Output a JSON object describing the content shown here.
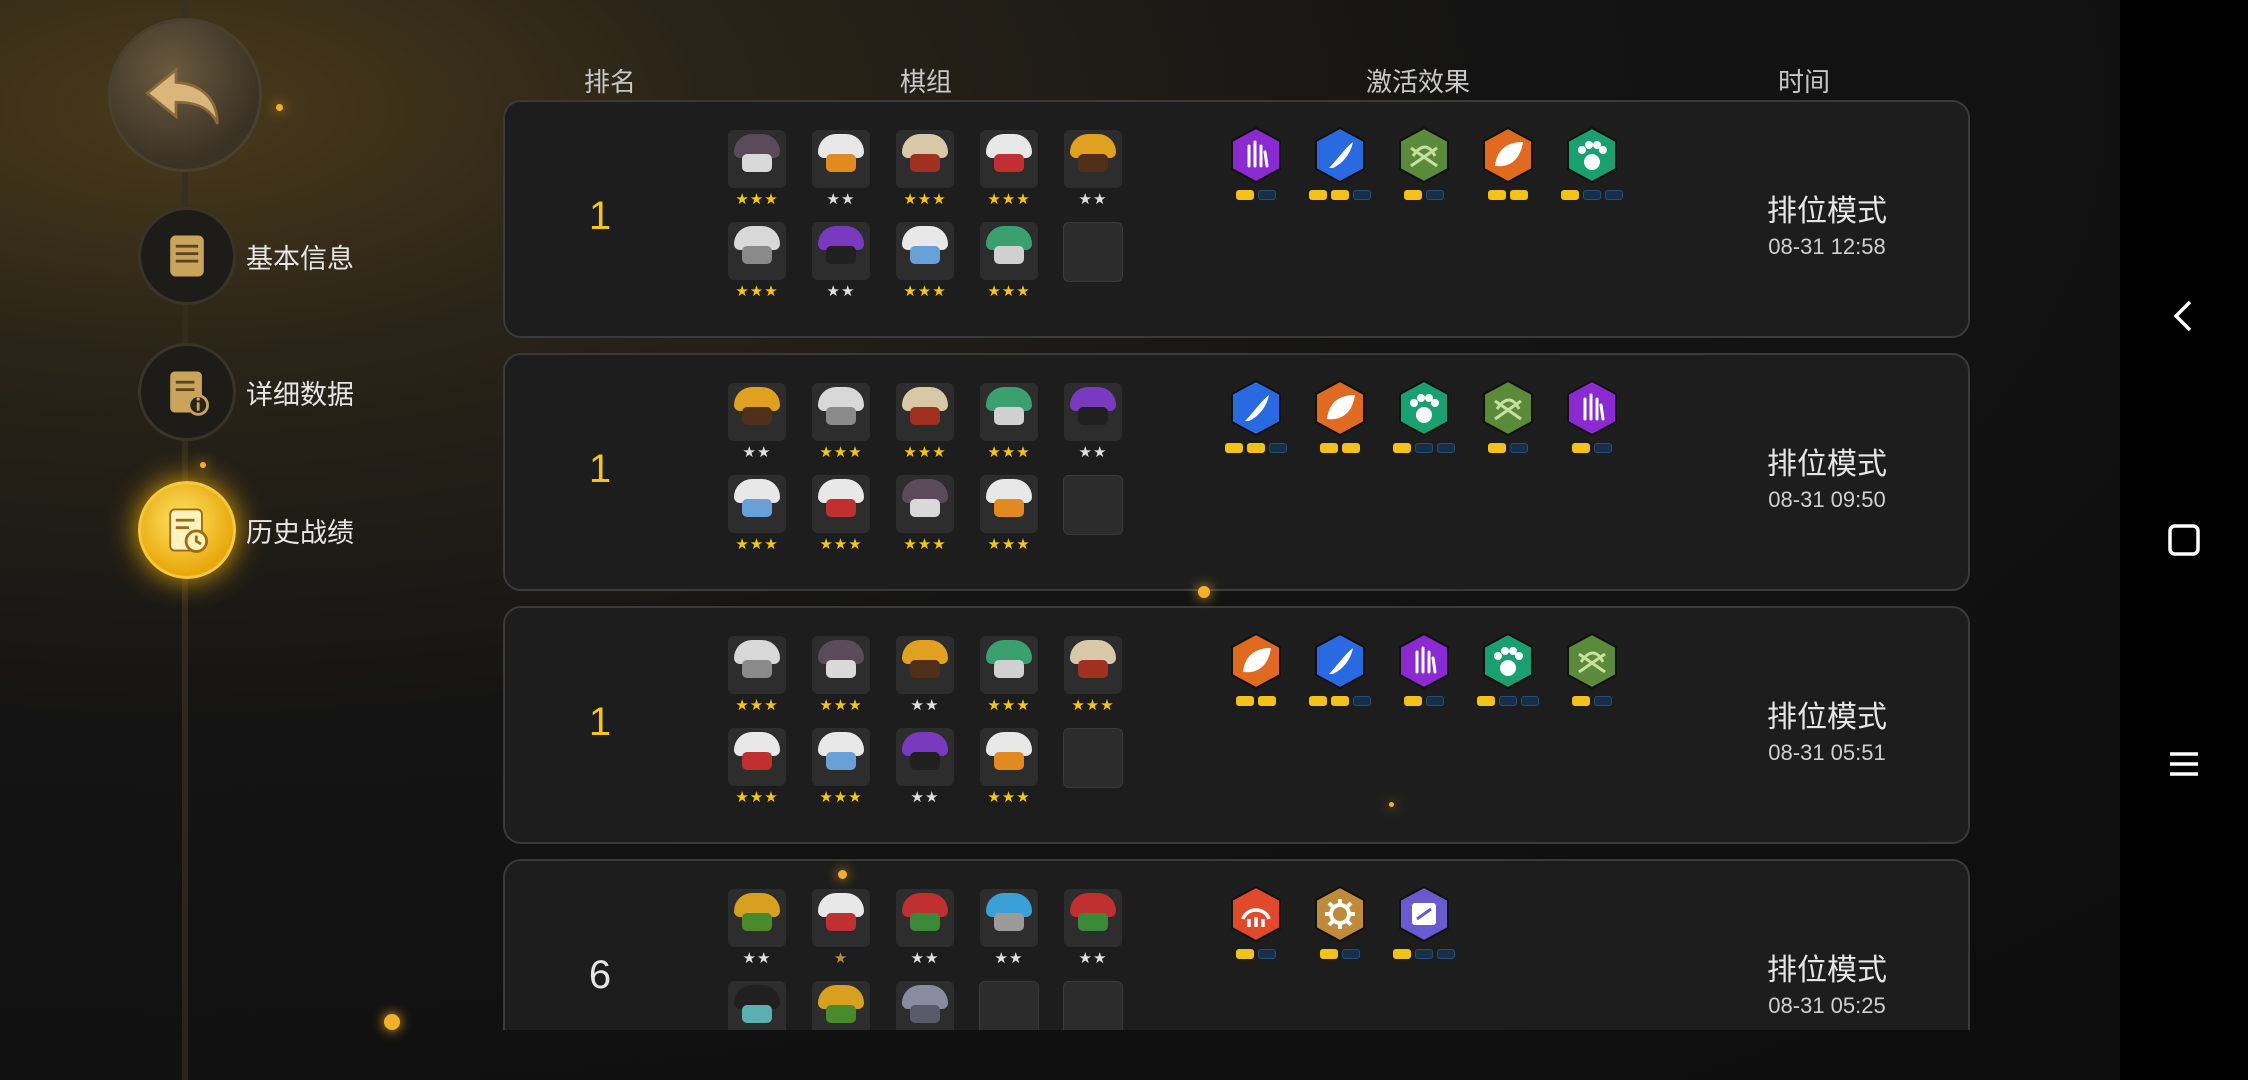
{
  "nav": {
    "items": [
      {
        "label": "基本信息",
        "icon": "notepad-icon"
      },
      {
        "label": "详细数据",
        "icon": "report-info-icon"
      },
      {
        "label": "历史战绩",
        "icon": "history-clock-icon"
      }
    ]
  },
  "columns": {
    "rank": "排名",
    "lineup": "棋组",
    "traits": "激活效果",
    "time": "时间"
  },
  "colors": {
    "accent": "#f5c518",
    "row_bg": "#1d1d1d"
  },
  "matches": [
    {
      "rank": "1",
      "mode": "排位模式",
      "time": "08-31 12:58",
      "units": [
        {
          "stars": "★★★",
          "tier": "gold",
          "hood": "#5a4a5a",
          "mask": "#d9d9d9"
        },
        {
          "stars": "★★",
          "tier": "silver",
          "hood": "#e8e8e8",
          "mask": "#e08a20"
        },
        {
          "stars": "★★★",
          "tier": "gold",
          "hood": "#d8c8a8",
          "mask": "#a03020"
        },
        {
          "stars": "★★★",
          "tier": "gold",
          "hood": "#e8e8e8",
          "mask": "#c03030"
        },
        {
          "stars": "★★",
          "tier": "silver",
          "hood": "#e0a020",
          "mask": "#503018"
        },
        {
          "stars": "★★★",
          "tier": "gold",
          "hood": "#d8d8d8",
          "mask": "#8a8a8a"
        },
        {
          "stars": "★★",
          "tier": "silver",
          "hood": "#7a3ac0",
          "mask": "#202020"
        },
        {
          "stars": "★★★",
          "tier": "gold",
          "hood": "#e8e8e8",
          "mask": "#6aa0d8"
        },
        {
          "stars": "★★★",
          "tier": "gold",
          "hood": "#3aa070",
          "mask": "#d0d0d0"
        },
        {
          "empty": true
        }
      ],
      "traits": [
        {
          "icon": "purple-hand-icon",
          "color": "#8a2ad0",
          "pips": [
            1,
            0
          ]
        },
        {
          "icon": "blue-feather-icon",
          "color": "#2a6ae0",
          "pips": [
            1,
            1,
            0
          ]
        },
        {
          "icon": "green-crossbow-icon",
          "color": "#5a8a3a",
          "pips": [
            1,
            0
          ]
        },
        {
          "icon": "orange-leaf-icon",
          "color": "#e06a20",
          "pips": [
            1,
            1
          ]
        },
        {
          "icon": "teal-paw-icon",
          "color": "#1aa070",
          "pips": [
            1,
            0,
            0
          ]
        }
      ]
    },
    {
      "rank": "1",
      "mode": "排位模式",
      "time": "08-31 09:50",
      "units": [
        {
          "stars": "★★",
          "tier": "silver",
          "hood": "#e0a020",
          "mask": "#503018"
        },
        {
          "stars": "★★★",
          "tier": "gold",
          "hood": "#d8d8d8",
          "mask": "#8a8a8a"
        },
        {
          "stars": "★★★",
          "tier": "gold",
          "hood": "#d8c8a8",
          "mask": "#a03020"
        },
        {
          "stars": "★★★",
          "tier": "gold",
          "hood": "#3aa070",
          "mask": "#d0d0d0"
        },
        {
          "stars": "★★",
          "tier": "silver",
          "hood": "#7a3ac0",
          "mask": "#202020"
        },
        {
          "stars": "★★★",
          "tier": "gold",
          "hood": "#e8e8e8",
          "mask": "#6aa0d8"
        },
        {
          "stars": "★★★",
          "tier": "gold",
          "hood": "#e8e8e8",
          "mask": "#c03030"
        },
        {
          "stars": "★★★",
          "tier": "gold",
          "hood": "#5a4a5a",
          "mask": "#d9d9d9"
        },
        {
          "stars": "★★★",
          "tier": "gold",
          "hood": "#e8e8e8",
          "mask": "#e08a20"
        },
        {
          "empty": true
        }
      ],
      "traits": [
        {
          "icon": "blue-feather-icon",
          "color": "#2a6ae0",
          "pips": [
            1,
            1,
            0
          ]
        },
        {
          "icon": "orange-leaf-icon",
          "color": "#e06a20",
          "pips": [
            1,
            1
          ]
        },
        {
          "icon": "teal-paw-icon",
          "color": "#1aa070",
          "pips": [
            1,
            0,
            0
          ]
        },
        {
          "icon": "green-crossbow-icon",
          "color": "#5a8a3a",
          "pips": [
            1,
            0
          ]
        },
        {
          "icon": "purple-hand-icon",
          "color": "#8a2ad0",
          "pips": [
            1,
            0
          ]
        }
      ]
    },
    {
      "rank": "1",
      "mode": "排位模式",
      "time": "08-31 05:51",
      "units": [
        {
          "stars": "★★★",
          "tier": "gold",
          "hood": "#d8d8d8",
          "mask": "#8a8a8a"
        },
        {
          "stars": "★★★",
          "tier": "gold",
          "hood": "#5a4a5a",
          "mask": "#d9d9d9"
        },
        {
          "stars": "★★",
          "tier": "silver",
          "hood": "#e0a020",
          "mask": "#503018"
        },
        {
          "stars": "★★★",
          "tier": "gold",
          "hood": "#3aa070",
          "mask": "#d0d0d0"
        },
        {
          "stars": "★★★",
          "tier": "gold",
          "hood": "#d8c8a8",
          "mask": "#a03020"
        },
        {
          "stars": "★★★",
          "tier": "gold",
          "hood": "#e8e8e8",
          "mask": "#c03030"
        },
        {
          "stars": "★★★",
          "tier": "gold",
          "hood": "#e8e8e8",
          "mask": "#6aa0d8"
        },
        {
          "stars": "★★",
          "tier": "silver",
          "hood": "#7a3ac0",
          "mask": "#202020"
        },
        {
          "stars": "★★★",
          "tier": "gold",
          "hood": "#e8e8e8",
          "mask": "#e08a20"
        },
        {
          "empty": true
        }
      ],
      "traits": [
        {
          "icon": "orange-leaf-icon",
          "color": "#e06a20",
          "pips": [
            1,
            1
          ]
        },
        {
          "icon": "blue-feather-icon",
          "color": "#2a6ae0",
          "pips": [
            1,
            1,
            0
          ]
        },
        {
          "icon": "purple-hand-icon",
          "color": "#8a2ad0",
          "pips": [
            1,
            0
          ]
        },
        {
          "icon": "teal-paw-icon",
          "color": "#1aa070",
          "pips": [
            1,
            0,
            0
          ]
        },
        {
          "icon": "green-crossbow-icon",
          "color": "#5a8a3a",
          "pips": [
            1,
            0
          ]
        }
      ]
    },
    {
      "rank": "6",
      "mode": "排位模式",
      "time": "08-31 05:25",
      "units": [
        {
          "stars": "★★",
          "tier": "silver",
          "hood": "#d8a020",
          "mask": "#4a8a2a"
        },
        {
          "stars": "★",
          "tier": "bronze",
          "hood": "#e8e8e8",
          "mask": "#c03030"
        },
        {
          "stars": "★★",
          "tier": "silver",
          "hood": "#c03030",
          "mask": "#3a8a3a"
        },
        {
          "stars": "★★",
          "tier": "silver",
          "hood": "#3aa0d8",
          "mask": "#9a9a9a"
        },
        {
          "stars": "★★",
          "tier": "silver",
          "hood": "#c03030",
          "mask": "#3a8a3a"
        },
        {
          "stars": "",
          "tier": "silver",
          "hood": "#202020",
          "mask": "#5ab0b0"
        },
        {
          "stars": "",
          "tier": "silver",
          "hood": "#d8a020",
          "mask": "#4a8a2a"
        },
        {
          "stars": "",
          "tier": "silver",
          "hood": "#8a8aa0",
          "mask": "#5a5a6a"
        },
        {
          "empty": true
        },
        {
          "empty": true
        }
      ],
      "traits": [
        {
          "icon": "red-tentacle-icon",
          "color": "#e04a2a",
          "pips": [
            1,
            0
          ]
        },
        {
          "icon": "bronze-gear-icon",
          "color": "#c08a3a",
          "pips": [
            1,
            0
          ]
        },
        {
          "icon": "violet-robot-icon",
          "color": "#6a5ad0",
          "pips": [
            1,
            0,
            0
          ]
        }
      ]
    }
  ]
}
